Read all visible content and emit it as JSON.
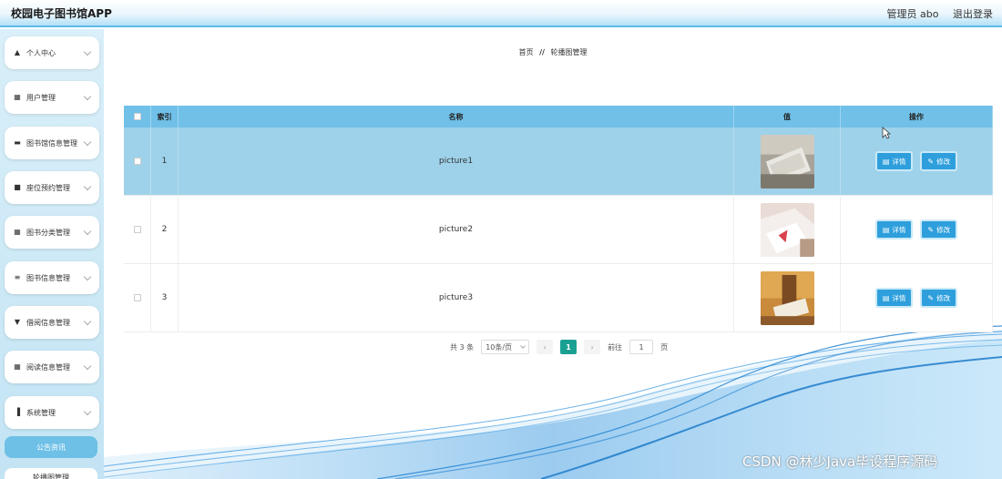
{
  "app": {
    "title": "校园电子图书馆APP"
  },
  "header": {
    "user": "管理员 abo",
    "logout": "退出登录"
  },
  "sidebar": {
    "items": [
      {
        "label": "个人中心",
        "icon": "user-icon"
      },
      {
        "label": "用户管理",
        "icon": "grid-icon"
      },
      {
        "label": "图书馆信息管理",
        "icon": "building-icon"
      },
      {
        "label": "座位预约管理",
        "icon": "square-icon"
      },
      {
        "label": "图书分类管理",
        "icon": "grid-icon"
      },
      {
        "label": "图书信息管理",
        "icon": "list-icon"
      },
      {
        "label": "借阅信息管理",
        "icon": "flag-icon"
      },
      {
        "label": "阅读信息管理",
        "icon": "grid-icon"
      },
      {
        "label": "系统管理",
        "icon": "bar-chart-icon"
      }
    ],
    "sub_items": [
      {
        "label": "公告资讯",
        "active": true
      },
      {
        "label": "轮播图管理",
        "active": false
      }
    ]
  },
  "breadcrumb": {
    "home": "首页",
    "separator": "//",
    "current": "轮播图管理"
  },
  "table": {
    "headers": {
      "index": "索引",
      "name": "名称",
      "value": "值",
      "actions": "操作"
    },
    "rows": [
      {
        "index": "1",
        "name": "picture1",
        "highlighted": true
      },
      {
        "index": "2",
        "name": "picture2",
        "highlighted": false
      },
      {
        "index": "3",
        "name": "picture3",
        "highlighted": false
      }
    ],
    "detail_label": "详情",
    "edit_label": "修改"
  },
  "pagination": {
    "total": "共 3 条",
    "page_size": "10条/页",
    "current_page": "1",
    "goto_label": "前往",
    "goto_value": "1",
    "page_unit": "页"
  },
  "watermark": "CSDN @林少Java毕设程序源码",
  "colors": {
    "accent": "#2e9fdc",
    "header": "#70c0e8",
    "highlight_row": "#9ed2ea",
    "pager_active": "#1aa093"
  }
}
